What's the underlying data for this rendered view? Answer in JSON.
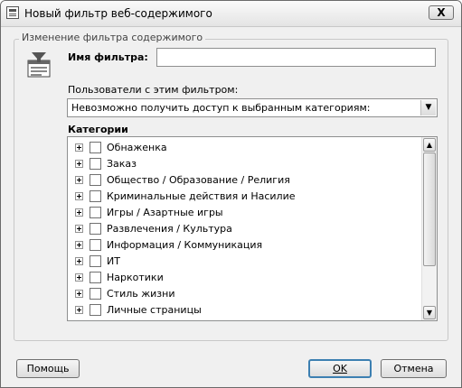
{
  "window": {
    "title": "Новый фильтр веб-содержимого",
    "close_glyph": "X"
  },
  "group": {
    "caption": "Изменение фильтра содержимого",
    "filter_name_label": "Имя фильтра:",
    "filter_name_value": "",
    "users_label": "Пользователи с этим фильтром:",
    "users_selected": "Невозможно получить доступ к выбранным категориям:",
    "categories_label": "Категории",
    "categories": [
      "Обнаженка",
      "Заказ",
      "Общество / Образование / Религия",
      "Криминальные действия и Насилие",
      "Игры / Азартные игры",
      "Развлечения / Культура",
      "Информация / Коммуникация",
      "ИТ",
      "Наркотики",
      "Стиль жизни",
      "Личные страницы"
    ]
  },
  "buttons": {
    "help": "Помощь",
    "ok": "OK",
    "cancel": "Отмена"
  },
  "icons": {
    "title": "app-window-icon",
    "filter": "content-filter-icon",
    "expand": "plus-box-icon",
    "dropdown": "chevron-down-icon",
    "scroll_up": "arrow-up-icon",
    "scroll_down": "arrow-down-icon"
  },
  "colors": {
    "default_button_border": "#3c7fb1",
    "window_bg": "#f0f0f0"
  }
}
